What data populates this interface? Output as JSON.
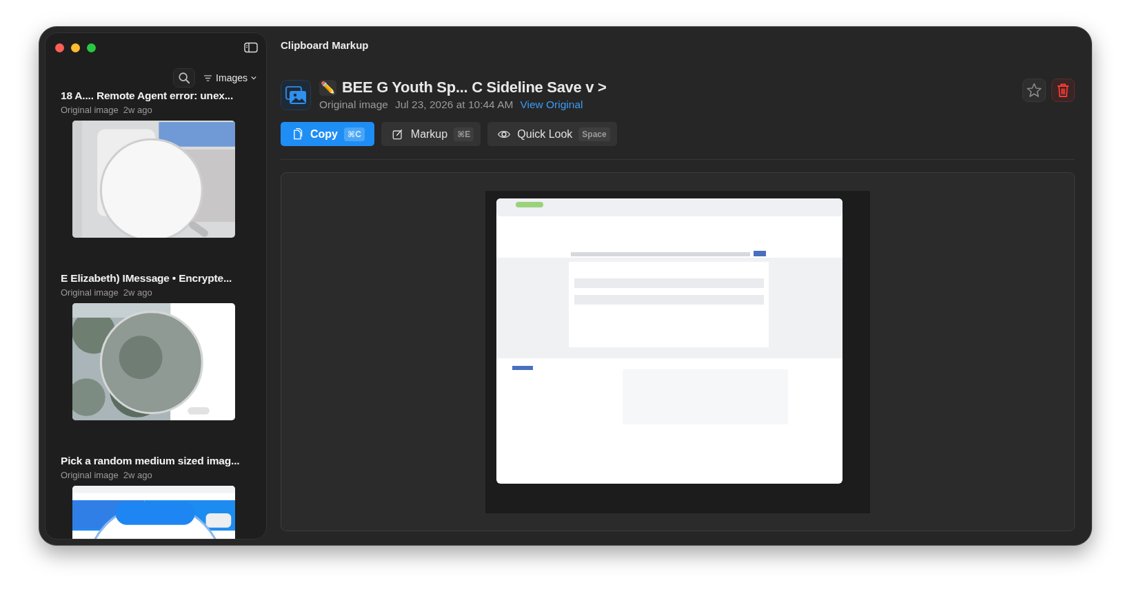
{
  "window": {
    "title": "Clipboard Markup"
  },
  "sidebar": {
    "filter_label": "Images",
    "items": [
      {
        "title": "18 A.... Remote Agent error: unex...",
        "type_label": "Original image",
        "age": "2w ago"
      },
      {
        "title": "E Elizabeth) IMessage • Encrypte...",
        "type_label": "Original image",
        "age": "2w ago"
      },
      {
        "title": "Pick a random medium sized imag...",
        "type_label": "Original image",
        "age": "2w ago"
      }
    ]
  },
  "detail": {
    "emoji": "✏️",
    "title": "BEE G Youth Sp... C Sideline Save v >",
    "type_label": "Original image",
    "date": "Jul 23, 2026 at 10:44 AM",
    "link": "View Original",
    "favorite": false,
    "actions": [
      {
        "label": "Copy",
        "shortcut": "⌘C",
        "primary": true
      },
      {
        "label": "Markup",
        "shortcut": "⌘E",
        "primary": false
      },
      {
        "label": "Quick Look",
        "shortcut": "Space",
        "primary": false
      }
    ]
  }
}
